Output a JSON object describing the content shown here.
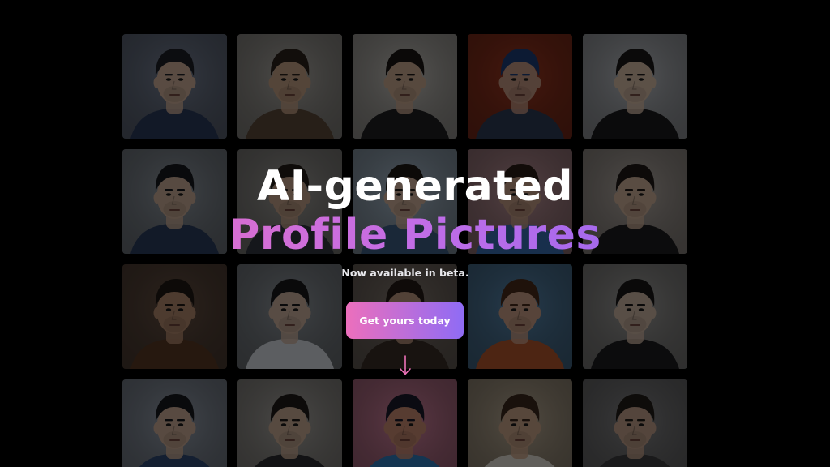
{
  "hero": {
    "line1": "AI-generated",
    "line2": "Profile Pictures",
    "subtitle": "Now available in beta.",
    "cta_label": "Get yours today",
    "arrow_icon": "arrow-down-icon"
  },
  "colors": {
    "background": "#000000",
    "gradient_start": "#ec6fbc",
    "gradient_end": "#8f6cf5",
    "headline": "#ffffff"
  },
  "gallery": {
    "rows": 4,
    "columns": 5,
    "tiles": [
      {
        "bg": "#7f8aa0",
        "hair": "#1c1f26",
        "skin": "#d3b39d",
        "shirt": "#2b3b5e"
      },
      {
        "bg": "#b9b6b0",
        "hair": "#2a211b",
        "skin": "#c9a488",
        "shirt": "#5c4a3a"
      },
      {
        "bg": "#d2cfc9",
        "hair": "#1b1613",
        "skin": "#d0ad94",
        "shirt": "#1f1f22"
      },
      {
        "bg": "#a83a22",
        "hair": "#1d3f7a",
        "skin": "#c99a85",
        "shirt": "#2e3b56"
      },
      {
        "bg": "#c9cdd3",
        "hair": "#1a1717",
        "skin": "#dcc0aa",
        "shirt": "#1b1b1d"
      },
      {
        "bg": "#9aa3ad",
        "hair": "#15171c",
        "skin": "#cfb09a",
        "shirt": "#2c3d5f"
      },
      {
        "bg": "#a7a5a1",
        "hair": "#241d18",
        "skin": "#c7a58c",
        "shirt": "#323641"
      },
      {
        "bg": "#b3c7d9",
        "hair": "#1c1714",
        "skin": "#d6b69f",
        "shirt": "#3f5f86"
      },
      {
        "bg": "#c89ba1",
        "hair": "#2a1d16",
        "skin": "#c79f88",
        "shirt": "#3a6fb4"
      },
      {
        "bg": "#c1b8b1",
        "hair": "#1e1815",
        "skin": "#d4b49c",
        "shirt": "#1d1c1e"
      },
      {
        "bg": "#6b5446",
        "hair": "#1e1712",
        "skin": "#b88c70",
        "shirt": "#5a3a24"
      },
      {
        "bg": "#9aa1a8",
        "hair": "#17181b",
        "skin": "#d1b6a3",
        "shirt": "#dadfe6"
      },
      {
        "bg": "#8b7f76",
        "hair": "#231b16",
        "skin": "#c49c82",
        "shirt": "#3a2d25"
      },
      {
        "bg": "#5d8fb8",
        "hair": "#4a2c1a",
        "skin": "#cfa289",
        "shirt": "#b8572d"
      },
      {
        "bg": "#a9a8a6",
        "hair": "#171616",
        "skin": "#d2b9a6",
        "shirt": "#1d1d1f"
      },
      {
        "bg": "#9fa9b8",
        "hair": "#16181d",
        "skin": "#d2b19a",
        "shirt": "#2f4a75"
      },
      {
        "bg": "#b5b2ad",
        "hair": "#1e1a17",
        "skin": "#ceaf98",
        "shirt": "#2a2b2f"
      },
      {
        "bg": "#e08aa8",
        "hair": "#1a1a2a",
        "skin": "#cf8e74",
        "shirt": "#2f7fc0"
      },
      {
        "bg": "#c7b79f",
        "hair": "#3b281c",
        "skin": "#d0a88c",
        "shirt": "#e8e2d8"
      },
      {
        "bg": "#8d8d8f",
        "hair": "#221c17",
        "skin": "#c8a58f",
        "shirt": "#3d3d40"
      }
    ]
  }
}
